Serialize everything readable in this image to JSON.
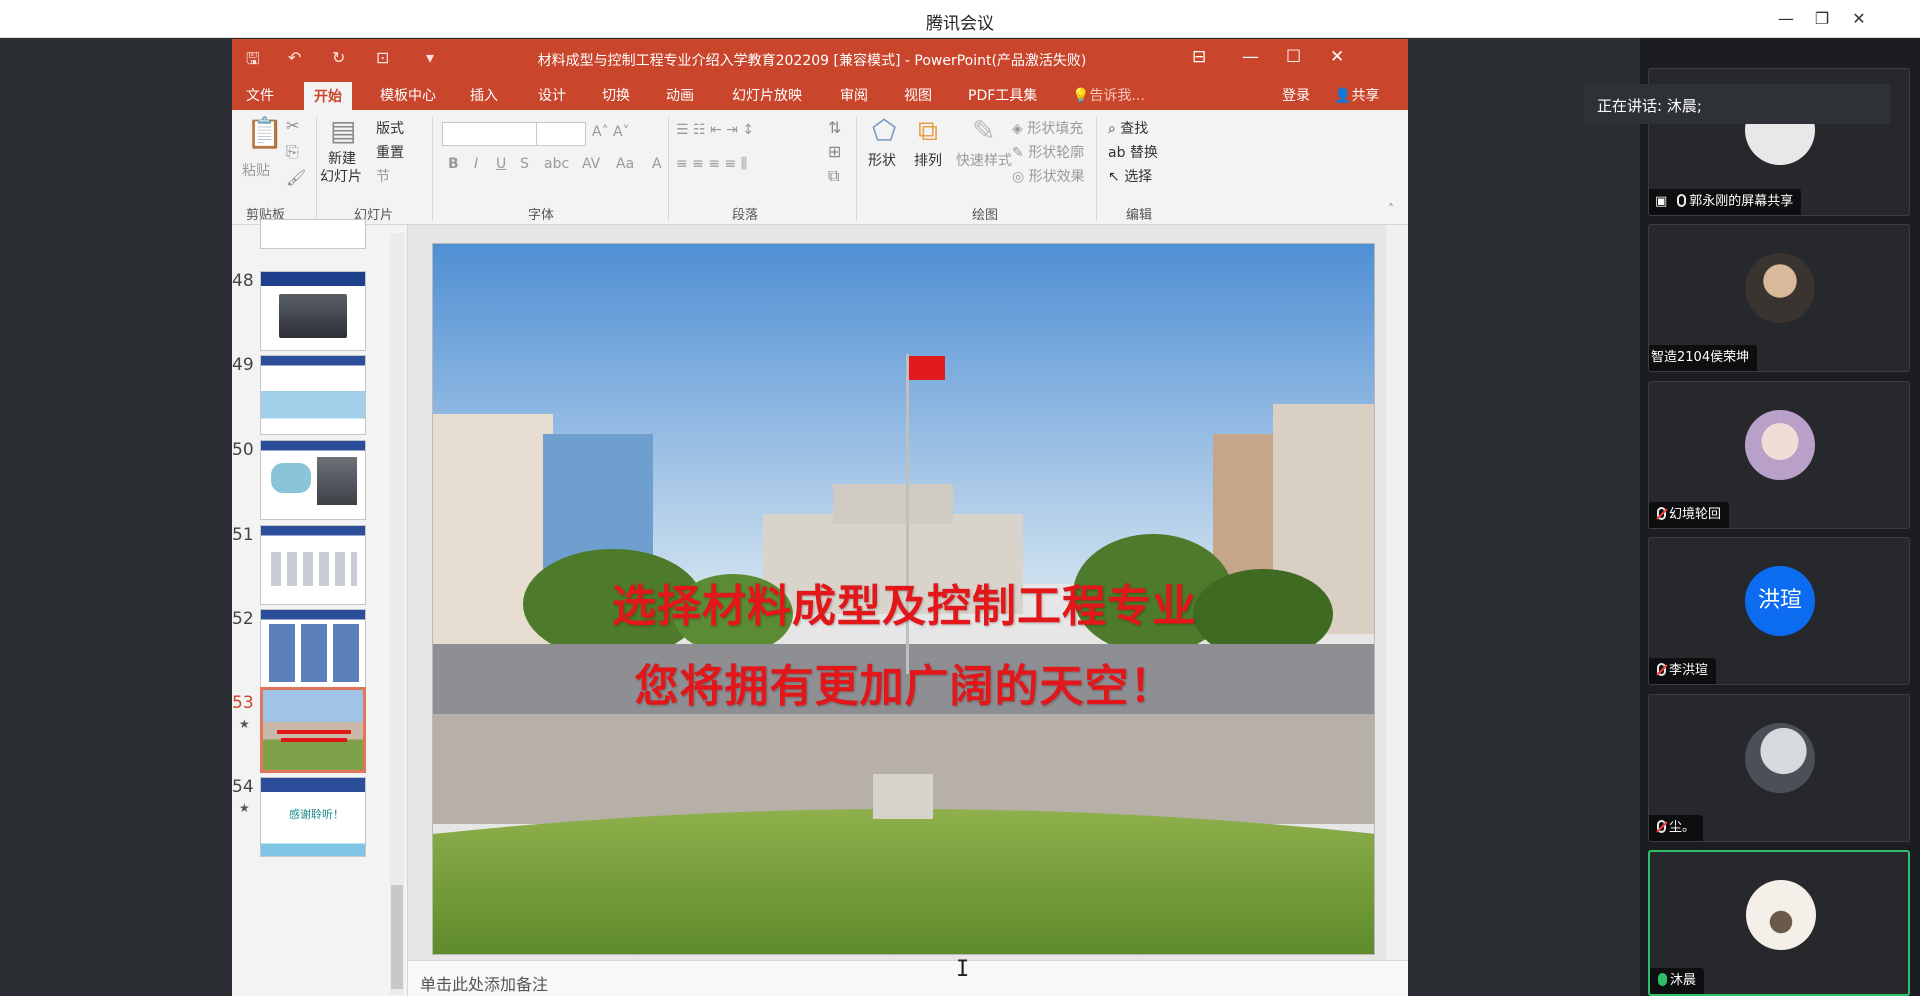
{
  "app": {
    "title": "腾讯会议"
  },
  "ppt": {
    "doc_title": "材料成型与控制工程专业介绍入学教育202209 [兼容模式] - PowerPoint(产品激活失败)",
    "tabs": [
      "文件",
      "开始",
      "模板中心",
      "插入",
      "设计",
      "切换",
      "动画",
      "幻灯片放映",
      "审阅",
      "视图",
      "PDF工具集"
    ],
    "tell_me": "告诉我...",
    "login": "登录",
    "share": "共享",
    "ribbon": {
      "clipboard": {
        "paste": "粘贴",
        "label": "剪贴板"
      },
      "slides": {
        "new_slide_line1": "新建",
        "new_slide_line2": "幻灯片",
        "layout": "版式",
        "reset": "重置",
        "section": "节",
        "label": "幻灯片"
      },
      "font": {
        "label": "字体"
      },
      "paragraph": {
        "label": "段落"
      },
      "drawing": {
        "shape": "形状",
        "arrange": "排列",
        "quick_style": "快速样式",
        "fill": "形状填充",
        "outline": "形状轮廓",
        "effect": "形状效果",
        "label": "绘图"
      },
      "editing": {
        "find": "查找",
        "replace": "替换",
        "select": "选择",
        "label": "编辑"
      }
    },
    "slide_numbers": [
      "48",
      "49",
      "50",
      "51",
      "52",
      "53",
      "54"
    ],
    "selected_slide": "53",
    "slide": {
      "line1": "选择材料成型及控制工程专业",
      "line2": "您将拥有更加广阔的天空！"
    },
    "thumb54_text": "感谢聆听！",
    "notes_placeholder": "单击此处添加备注"
  },
  "meeting": {
    "speaking_label": "正在讲话: 沐晨;",
    "participants": [
      {
        "name": "郭永刚的屏幕共享",
        "mic": "sharing"
      },
      {
        "name": "智造2104侯荣坤",
        "mic": "none"
      },
      {
        "name": "幻境轮回",
        "mic": "muted"
      },
      {
        "name": "李洪瑄",
        "mic": "muted",
        "avatar_text": "洪瑄"
      },
      {
        "name": "尘。",
        "mic": "muted"
      },
      {
        "name": "沐晨",
        "mic": "on"
      }
    ]
  },
  "colors": {
    "ppt_accent": "#c9452b",
    "title_red": "#e3161a",
    "avatar_blue": "#0c6cf0",
    "active_green": "#2fbf6a"
  }
}
